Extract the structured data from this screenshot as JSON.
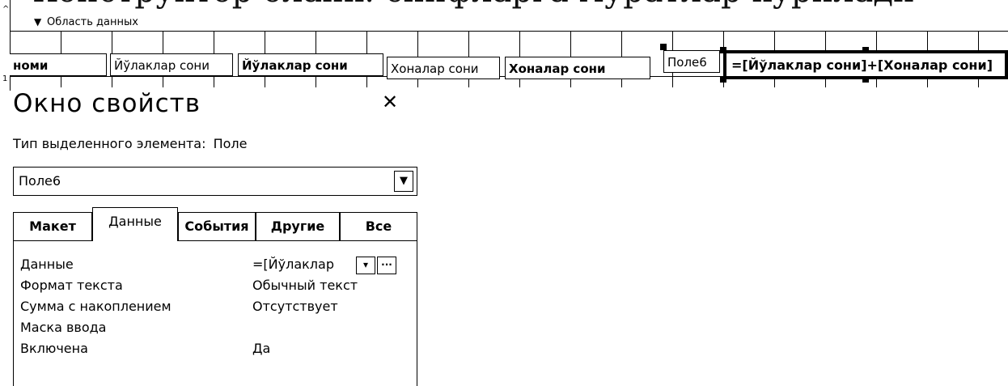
{
  "top_text": "Конструктор бланк: синфларга муратлар кўрилади",
  "section": {
    "arrow": "▼",
    "label": "Область данных"
  },
  "ruler": {
    "mark": "1"
  },
  "controls": [
    {
      "text": "номи",
      "bold": true
    },
    {
      "text": "Йўлаклар сони",
      "bold": false
    },
    {
      "text": "Йўлаклар сони",
      "bold": true
    },
    {
      "text": "Хоналар сони",
      "bold": false
    },
    {
      "text": "Хоналар сони",
      "bold": true
    },
    {
      "text": "Поле6",
      "bold": false
    },
    {
      "text": "=[Йўлаклар сони]+[Хоналар сони]",
      "bold": true
    }
  ],
  "property_sheet": {
    "title": "Окно свойств",
    "close": "✕",
    "type_label": "Тип выделенного элемента:",
    "type_value": "Поле",
    "selected": "Поле6",
    "tabs": [
      "Макет",
      "Данные",
      "События",
      "Другие",
      "Все"
    ],
    "active_tab": "Данные",
    "rows": [
      {
        "name": "Данные",
        "value": "=[Йўлаклар"
      },
      {
        "name": "Формат текста",
        "value": "Обычный текст"
      },
      {
        "name": "Сумма с накоплением",
        "value": "Отсутствует"
      },
      {
        "name": "Маска ввода",
        "value": ""
      },
      {
        "name": "Включена",
        "value": "Да"
      }
    ]
  }
}
